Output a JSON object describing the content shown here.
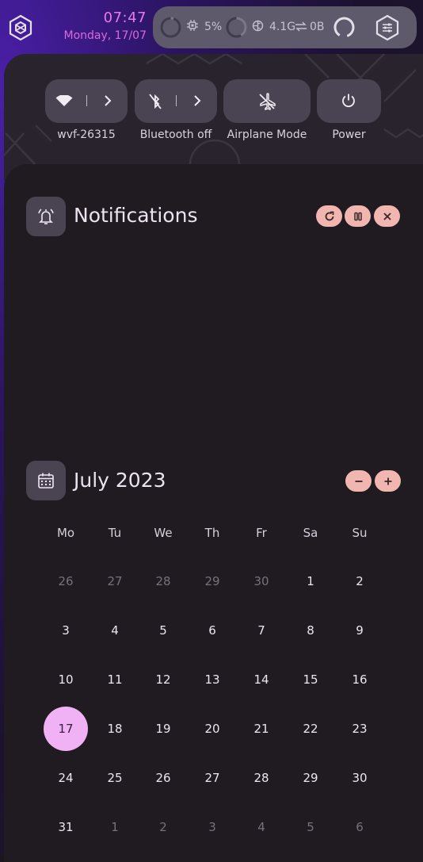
{
  "topbar": {
    "time": "07:47",
    "date": "Monday, 17/07",
    "cpu_label": "5%",
    "cpu_fraction": 0.05,
    "mem_label": "4.1G",
    "net_label": "0B",
    "icons": [
      "hexagon-menu-icon",
      "cpu-icon",
      "memory-icon",
      "transfer-icon",
      "settings-sliders-icon"
    ]
  },
  "quick_settings": {
    "tiles": [
      {
        "label": "wvf-26315",
        "icon": "wifi-icon",
        "expandable": true
      },
      {
        "label": "Bluetooth off",
        "icon": "bluetooth-off-icon",
        "expandable": true
      },
      {
        "label": "Airplane Mode",
        "icon": "airplane-off-icon",
        "expandable": false
      },
      {
        "label": "Power",
        "icon": "power-icon",
        "expandable": false
      }
    ]
  },
  "notifications": {
    "title": "Notifications",
    "actions": [
      "refresh-icon",
      "pause-icon",
      "close-icon"
    ]
  },
  "calendar": {
    "title": "July 2023",
    "weekdays": [
      "Mo",
      "Tu",
      "We",
      "Th",
      "Fr",
      "Sa",
      "Su"
    ],
    "weeks": [
      [
        {
          "d": "26",
          "dim": true
        },
        {
          "d": "27",
          "dim": true
        },
        {
          "d": "28",
          "dim": true
        },
        {
          "d": "29",
          "dim": true
        },
        {
          "d": "30",
          "dim": true
        },
        {
          "d": "1"
        },
        {
          "d": "2"
        }
      ],
      [
        {
          "d": "3"
        },
        {
          "d": "4"
        },
        {
          "d": "5"
        },
        {
          "d": "6"
        },
        {
          "d": "7"
        },
        {
          "d": "8"
        },
        {
          "d": "9"
        }
      ],
      [
        {
          "d": "10"
        },
        {
          "d": "11"
        },
        {
          "d": "12"
        },
        {
          "d": "13"
        },
        {
          "d": "14"
        },
        {
          "d": "15"
        },
        {
          "d": "16"
        }
      ],
      [
        {
          "d": "17",
          "today": true
        },
        {
          "d": "18"
        },
        {
          "d": "19"
        },
        {
          "d": "20"
        },
        {
          "d": "21"
        },
        {
          "d": "22"
        },
        {
          "d": "23"
        }
      ],
      [
        {
          "d": "24"
        },
        {
          "d": "25"
        },
        {
          "d": "26"
        },
        {
          "d": "27"
        },
        {
          "d": "28"
        },
        {
          "d": "29"
        },
        {
          "d": "30"
        }
      ],
      [
        {
          "d": "31"
        },
        {
          "d": "1",
          "dim": true
        },
        {
          "d": "2",
          "dim": true
        },
        {
          "d": "3",
          "dim": true
        },
        {
          "d": "4",
          "dim": true
        },
        {
          "d": "5",
          "dim": true
        },
        {
          "d": "6",
          "dim": true
        }
      ]
    ]
  },
  "colors": {
    "accent": "#e879e8",
    "today_bg": "#f0b2f4",
    "action_pill": "#f1b6b0",
    "tile_bg": "#4a4351"
  }
}
